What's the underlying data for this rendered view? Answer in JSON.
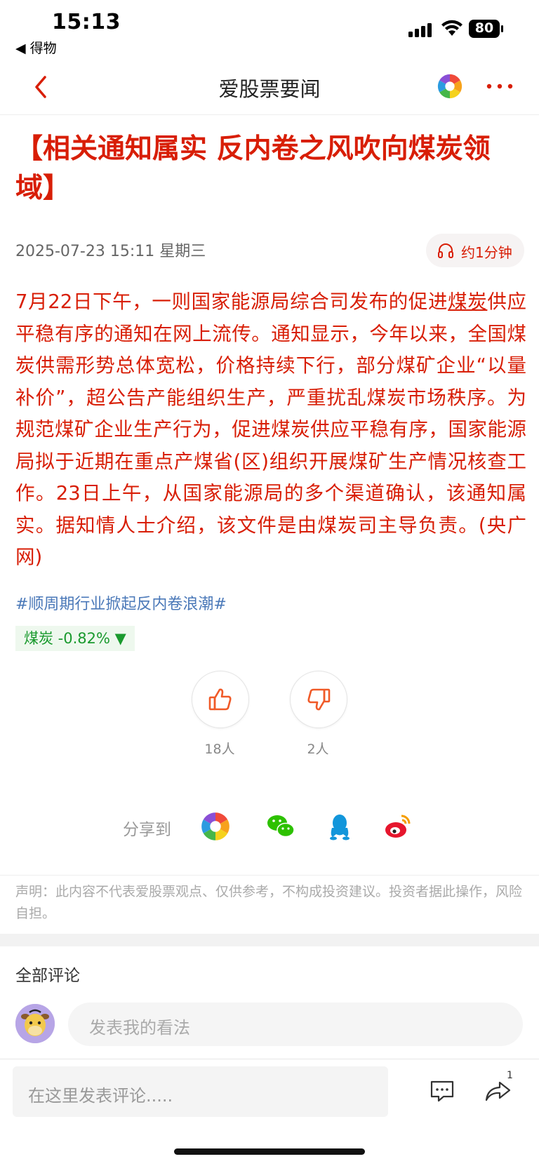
{
  "status_bar": {
    "time": "15:13",
    "back_app": "◀ 得物",
    "battery": "80"
  },
  "nav": {
    "title": "爱股票要闻"
  },
  "article": {
    "headline": "【相关通知属实 反内卷之风吹向煤炭领域】",
    "date": "2025-07-23 15:11 星期三",
    "listen_label": "约1分钟",
    "body_before": "7月22日下午，一则国家能源局综合司发布的促进",
    "body_keyword": "煤炭",
    "body_after": "供应平稳有序的通知在网上流传。通知显示，今年以来，全国煤炭供需形势总体宽松，价格持续下行，部分煤矿企业“以量补价”，超公告产能组织生产，严重扰乱煤炭市场秩序。为规范煤矿企业生产行为，促进煤炭供应平稳有序，国家能源局拟于近期在重点产煤省(区)组织开展煤矿生产情况核查工作。23日上午，从国家能源局的多个渠道确认，该通知属实。据知情人士介绍，该文件是由煤炭司主导负责。(央广网)",
    "topic": "#顺周期行业掀起反内卷浪潮#",
    "stock_tag": "煤炭 -0.82% ▼"
  },
  "votes": {
    "like_count": "18人",
    "dislike_count": "2人"
  },
  "share": {
    "label": "分享到"
  },
  "disclaimer": "声明：此内容不代表爱股票观点、仅供参考，不构成投资建议。投资者据此操作，风险自担。",
  "comments": {
    "title": "全部评论",
    "opinion_placeholder": "发表我的看法",
    "input_placeholder": "在这里发表评论.....",
    "share_badge": "1"
  },
  "colors": {
    "accent": "#d81e06",
    "topic": "#4a78b8",
    "stock_down": "#1a9a2e"
  },
  "icons": [
    "back-chevron-icon",
    "app-logo-icon",
    "more-icon",
    "headphone-icon",
    "thumbs-up-icon",
    "thumbs-down-icon",
    "wechat-icon",
    "qq-icon",
    "weibo-icon",
    "comment-icon",
    "share-arrow-icon"
  ]
}
